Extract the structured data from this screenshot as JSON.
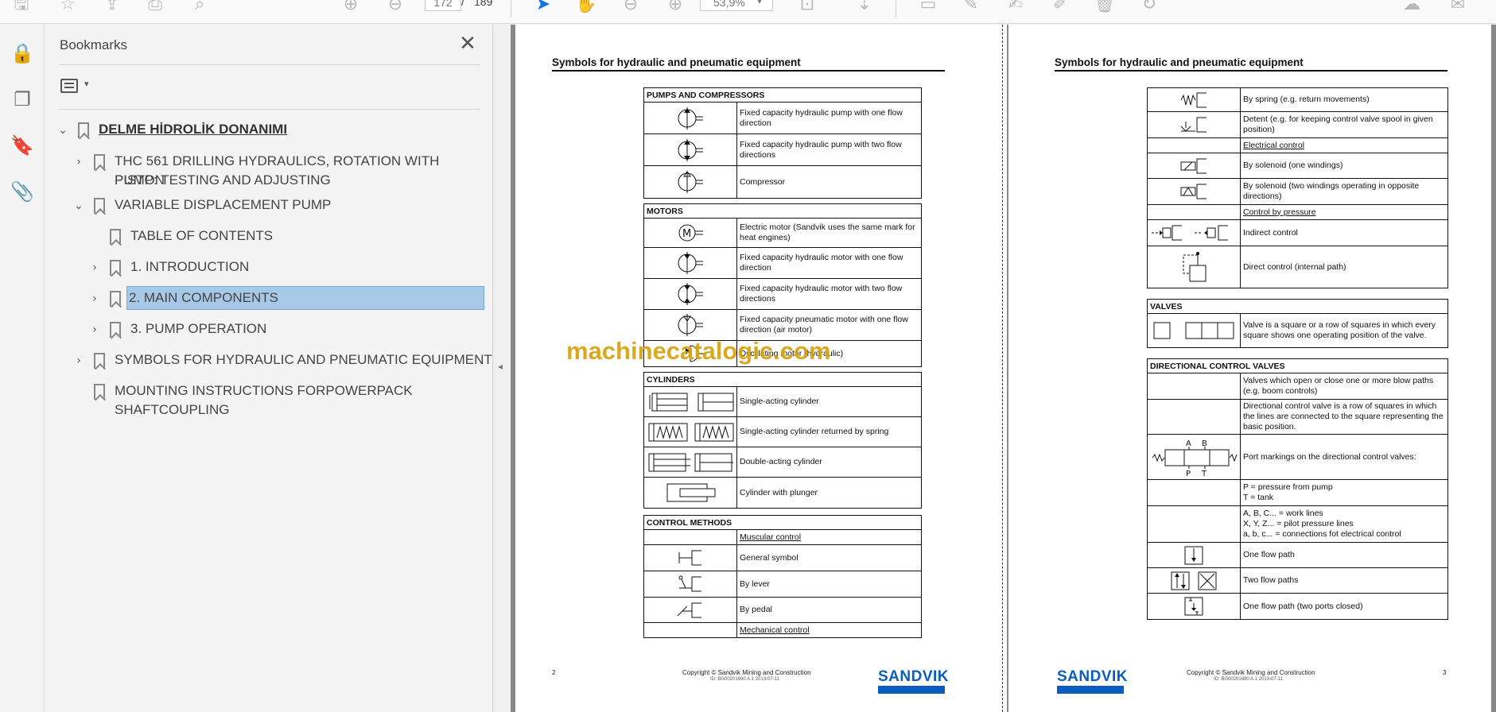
{
  "toolbar": {
    "page_current": "172",
    "page_sep": "/",
    "page_total": "189",
    "zoom": "53,9%",
    "icons": [
      "save-icon",
      "star-icon",
      "upload-icon",
      "print-icon",
      "search-icon",
      "page-up-icon",
      "page-down-icon",
      "select-cursor-icon",
      "hand-icon",
      "zoom-out-icon",
      "zoom-in-icon",
      "fit-page-icon",
      "scroll-icon",
      "comment-icon",
      "highlight-icon",
      "draw-icon",
      "edit-icon",
      "delete-icon",
      "rotate-icon",
      "share-icon",
      "email-icon"
    ]
  },
  "left_rail": {
    "icons": [
      "lock-icon",
      "pages-icon",
      "bookmark-icon",
      "paperclip-icon"
    ]
  },
  "bookmarks": {
    "title": "Bookmarks",
    "items": [
      {
        "label": "DELME HİDROLİK DONANIMI",
        "level": 0,
        "toggle": "expanded",
        "selected": false,
        "bold": true
      },
      {
        "label": "THC 561 DRILLING HYDRAULICS, ROTATION WITH PISTON",
        "label2": "PUMP: TESTING AND ADJUSTING",
        "level": 1,
        "toggle": "collapsed",
        "selected": false
      },
      {
        "label": "VARIABLE DISPLACEMENT PUMP",
        "level": 1,
        "toggle": "expanded",
        "selected": false
      },
      {
        "label": "TABLE OF CONTENTS",
        "level": 2,
        "toggle": "none",
        "selected": false
      },
      {
        "label": "1. INTRODUCTION",
        "level": 2,
        "toggle": "collapsed",
        "selected": false
      },
      {
        "label": "2. MAIN COMPONENTS",
        "level": 2,
        "toggle": "collapsed",
        "selected": true
      },
      {
        "label": "3. PUMP OPERATION",
        "level": 2,
        "toggle": "collapsed",
        "selected": false
      },
      {
        "label": "SYMBOLS FOR HYDRAULIC AND PNEUMATIC EQUIPMENT",
        "level": 1,
        "toggle": "collapsed",
        "selected": false
      },
      {
        "label": "MOUNTING INSTRUCTIONS FORPOWERPACK",
        "label2": "SHAFTCOUPLING",
        "level": 1,
        "toggle": "none",
        "selected": false
      }
    ]
  },
  "page_left": {
    "heading": "Symbols for hydraulic and pneumatic equipment",
    "pumps_title": "PUMPS AND COMPRESSORS",
    "pumps": [
      "Fixed capacity hydraulic pump with one flow direction",
      "Fixed capacity hydraulic pump with two flow directions",
      "Compressor"
    ],
    "motors_title": "MOTORS",
    "motors": [
      "Electric motor (Sandvik uses the same mark for heat engines)",
      "Fixed capacity hydraulic motor with one flow direction",
      "Fixed capacity hydraulic motor with two flow directions",
      "Fixed capacity pneumatic motor with one flow direction (air motor)",
      "Oscillating motor (hydraulic)"
    ],
    "cylinders_title": "CYLINDERS",
    "cylinders": [
      "Single-acting cylinder",
      "Single-acting cylinder returned by spring",
      "Double-acting cylinder",
      "Cylinder with plunger"
    ],
    "control_title": "CONTROL METHODS",
    "control": [
      "Muscular control",
      "General symbol",
      "By lever",
      "By pedal",
      "Mechanical control"
    ],
    "page_number": "2",
    "copyright": "Copyright © Sandvik Mining and Construction",
    "doc_id": "ID: BG00201690 A.1 2013-07-11",
    "logo": "SANDVIK"
  },
  "page_right": {
    "heading": "Symbols for hydraulic and pneumatic equipment",
    "control_rows": [
      "By spring (e.g. return movements)",
      "Detent (e.g. for keeping control valve spool in given position)",
      "Electrical control",
      "By solenoid (one windings)",
      "By solenoid (two windings operating in opposite directions)",
      "Control by pressure",
      "Indirect control",
      "Direct control (internal path)"
    ],
    "valves_title": "VALVES",
    "valves": [
      "Valve is a square or a row of squares in which every square shows one operating position of the valve."
    ],
    "dcv_title": "DIRECTIONAL CONTROL VALVES",
    "dcv": [
      "Valves which open or close one or more blow paths (e.g. boom controls)",
      "Directional control valve is a row of squares in which the lines are connected to the square representing the basic position.",
      "Port markings on the directional control valves:",
      "P = pressure from pump\nT = tank",
      "A, B, C... = work lines\nX, Y, Z... = pilot pressure lines\na, b, c... = connections fot electrical control",
      "One flow path",
      "Two flow paths",
      "One flow path (two ports closed)"
    ],
    "port_labels": {
      "a": "A",
      "b": "B",
      "p": "P",
      "t": "T"
    },
    "page_number": "3",
    "copyright": "Copyright © Sandvik Mining and Construction",
    "doc_id": "ID: BG00201690 A.1 2013-07-11",
    "logo": "SANDVIK"
  },
  "watermark": "machinecatalogic.com",
  "colors": {
    "accent": "#1473e6",
    "selection": "#a8c8e8",
    "watermark": "#d9a20f",
    "brand": "#0a5cbf"
  }
}
